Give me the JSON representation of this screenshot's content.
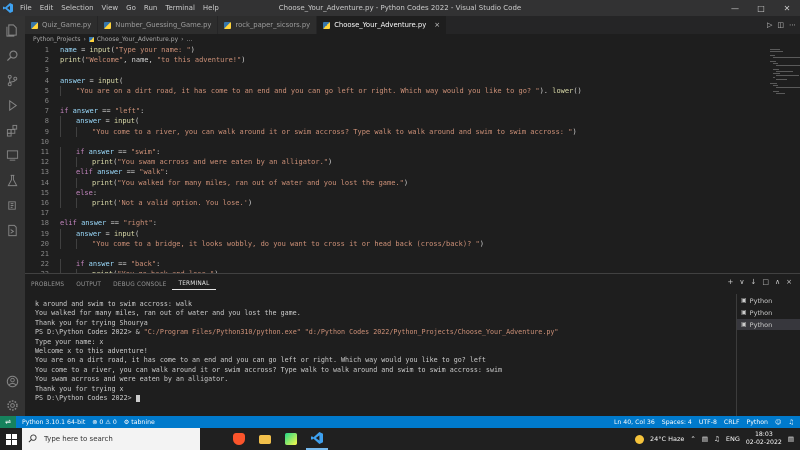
{
  "window": {
    "title": "Choose_Your_Adventure.py - Python Codes 2022 - Visual Studio Code",
    "menu": [
      "File",
      "Edit",
      "Selection",
      "View",
      "Go",
      "Run",
      "Terminal",
      "Help"
    ]
  },
  "tabs": [
    {
      "label": "Quiz_Game.py",
      "active": false
    },
    {
      "label": "Number_Guessing_Game.py",
      "active": false
    },
    {
      "label": "rock_paper_sicsors.py",
      "active": false
    },
    {
      "label": "Choose_Your_Adventure.py",
      "active": true
    }
  ],
  "breadcrumb": {
    "folder": "Python_Projects",
    "file": "Choose_Your_Adventure.py",
    "rest": "..."
  },
  "editor": {
    "lines": [
      {
        "n": "1",
        "indent": 0,
        "tokens": [
          [
            "var",
            "name"
          ],
          [
            "op",
            " = "
          ],
          [
            "fn",
            "input"
          ],
          [
            "op",
            "("
          ],
          [
            "str",
            "\"Type your name: \""
          ],
          [
            "op",
            ")"
          ]
        ]
      },
      {
        "n": "2",
        "indent": 0,
        "tokens": [
          [
            "fn",
            "print"
          ],
          [
            "op",
            "("
          ],
          [
            "str",
            "\"Welcome\""
          ],
          [
            "op",
            ", name, "
          ],
          [
            "str",
            "\"to this adventure!\""
          ],
          [
            "op",
            ")"
          ]
        ]
      },
      {
        "n": "3",
        "indent": 0,
        "tokens": []
      },
      {
        "n": "4",
        "indent": 0,
        "tokens": [
          [
            "var",
            "answer"
          ],
          [
            "op",
            " = "
          ],
          [
            "fn",
            "input"
          ],
          [
            "op",
            "("
          ]
        ]
      },
      {
        "n": "5",
        "indent": 1,
        "tokens": [
          [
            "str",
            "\"You are on a dirt road, it has come to an end and you can go left or right. Which way would you like to go? \""
          ],
          [
            "op",
            "). "
          ],
          [
            "fn",
            "lower"
          ],
          [
            "op",
            "()"
          ]
        ]
      },
      {
        "n": "6",
        "indent": 0,
        "tokens": []
      },
      {
        "n": "7",
        "indent": 0,
        "tokens": [
          [
            "kw",
            "if"
          ],
          [
            "var",
            " answer"
          ],
          [
            "op",
            " == "
          ],
          [
            "str",
            "\"left\""
          ],
          [
            "op",
            ":"
          ]
        ]
      },
      {
        "n": "8",
        "indent": 1,
        "tokens": [
          [
            "var",
            "answer"
          ],
          [
            "op",
            " = "
          ],
          [
            "fn",
            "input"
          ],
          [
            "op",
            "("
          ]
        ]
      },
      {
        "n": "9",
        "indent": 2,
        "tokens": [
          [
            "str",
            "\"You come to a river, you can walk around it or swim accross? Type walk to walk around and swim to swim accross: \""
          ],
          [
            "op",
            ")"
          ]
        ]
      },
      {
        "n": "10",
        "indent": 0,
        "tokens": []
      },
      {
        "n": "11",
        "indent": 1,
        "tokens": [
          [
            "kw",
            "if"
          ],
          [
            "var",
            " answer"
          ],
          [
            "op",
            " == "
          ],
          [
            "str",
            "\"swim\""
          ],
          [
            "op",
            ":"
          ]
        ]
      },
      {
        "n": "12",
        "indent": 2,
        "tokens": [
          [
            "fn",
            "print"
          ],
          [
            "op",
            "("
          ],
          [
            "str",
            "\"You swam acrross and were eaten by an alligator.\""
          ],
          [
            "op",
            ")"
          ]
        ]
      },
      {
        "n": "13",
        "indent": 1,
        "tokens": [
          [
            "kw",
            "elif"
          ],
          [
            "var",
            " answer"
          ],
          [
            "op",
            " == "
          ],
          [
            "str",
            "\"walk\""
          ],
          [
            "op",
            ":"
          ]
        ]
      },
      {
        "n": "14",
        "indent": 2,
        "tokens": [
          [
            "fn",
            "print"
          ],
          [
            "op",
            "("
          ],
          [
            "str",
            "\"You walked for many miles, ran out of water and you lost the game.\""
          ],
          [
            "op",
            ")"
          ]
        ]
      },
      {
        "n": "15",
        "indent": 1,
        "tokens": [
          [
            "kw",
            "else"
          ],
          [
            "op",
            ":"
          ]
        ]
      },
      {
        "n": "16",
        "indent": 2,
        "tokens": [
          [
            "fn",
            "print"
          ],
          [
            "op",
            "("
          ],
          [
            "str",
            "'Not a valid option. You lose.'"
          ],
          [
            "op",
            ")"
          ]
        ]
      },
      {
        "n": "17",
        "indent": 0,
        "tokens": []
      },
      {
        "n": "18",
        "indent": 0,
        "tokens": [
          [
            "kw",
            "elif"
          ],
          [
            "var",
            " answer"
          ],
          [
            "op",
            " == "
          ],
          [
            "str",
            "\"right\""
          ],
          [
            "op",
            ":"
          ]
        ]
      },
      {
        "n": "19",
        "indent": 1,
        "tokens": [
          [
            "var",
            "answer"
          ],
          [
            "op",
            " = "
          ],
          [
            "fn",
            "input"
          ],
          [
            "op",
            "("
          ]
        ]
      },
      {
        "n": "20",
        "indent": 2,
        "tokens": [
          [
            "str",
            "\"You come to a bridge, it looks wobbly, do you want to cross it or head back (cross/back)? \""
          ],
          [
            "op",
            ")"
          ]
        ]
      },
      {
        "n": "21",
        "indent": 0,
        "tokens": []
      },
      {
        "n": "22",
        "indent": 1,
        "tokens": [
          [
            "kw",
            "if"
          ],
          [
            "var",
            " answer"
          ],
          [
            "op",
            " == "
          ],
          [
            "str",
            "\"back\""
          ],
          [
            "op",
            ":"
          ]
        ]
      },
      {
        "n": "23",
        "indent": 2,
        "tokens": [
          [
            "fn",
            "print"
          ],
          [
            "op",
            "("
          ],
          [
            "str",
            "\"You go back and lose.\""
          ],
          [
            "op",
            ")"
          ]
        ]
      }
    ]
  },
  "panel": {
    "tabs": [
      "PROBLEMS",
      "OUTPUT",
      "DEBUG CONSOLE",
      "TERMINAL"
    ],
    "active_tab": "TERMINAL",
    "actions": [
      "+",
      "∨",
      "↓",
      "□",
      "∧",
      "×"
    ],
    "terminal_lines": [
      [
        [
          "",
          "k around and swim to swim accross: walk"
        ]
      ],
      [
        [
          "",
          "You walked for many miles, ran out of water and you lost the game."
        ]
      ],
      [
        [
          "",
          "Thank you for trying Shourya"
        ]
      ],
      [
        [
          "",
          "PS D:\\Python Codes 2022> & "
        ],
        [
          "str",
          "\"C:/Program Files/Python310/python.exe\""
        ],
        [
          "",
          " "
        ],
        [
          "str",
          "\"d:/Python Codes 2022/Python_Projects/Choose_Your_Adventure.py\""
        ]
      ],
      [
        [
          "",
          "Type your name: x"
        ]
      ],
      [
        [
          "",
          "Welcome x to this adventure!"
        ]
      ],
      [
        [
          "",
          "You are on a dirt road, it has come to an end and you can go left or right. Which way would you like to go? left"
        ]
      ],
      [
        [
          "",
          "You come to a river, you can walk around it or swim accross? Type walk to walk around and swim to swim accross: swim"
        ]
      ],
      [
        [
          "",
          "You swam acrross and were eaten by an alligator."
        ]
      ],
      [
        [
          "",
          "Thank you for trying x"
        ]
      ],
      [
        [
          "",
          "PS D:\\Python Codes 2022> "
        ]
      ]
    ],
    "terminal_list": [
      "Python",
      "Python",
      "Python"
    ]
  },
  "statusbar": {
    "interpreter": "Python 3.10.1 64-bit",
    "problems": "⊗ 0 ⚠ 0",
    "tabnine": "⚙ tabnine",
    "position": "Ln 40, Col 36",
    "spaces": "Spaces: 4",
    "encoding": "UTF-8",
    "eol": "CRLF",
    "language": "Python"
  },
  "taskbar": {
    "search_placeholder": "Type here to search",
    "weather": "24°C  Haze",
    "lang": "ENG",
    "time": "18:03",
    "date": "02-02-2022"
  }
}
